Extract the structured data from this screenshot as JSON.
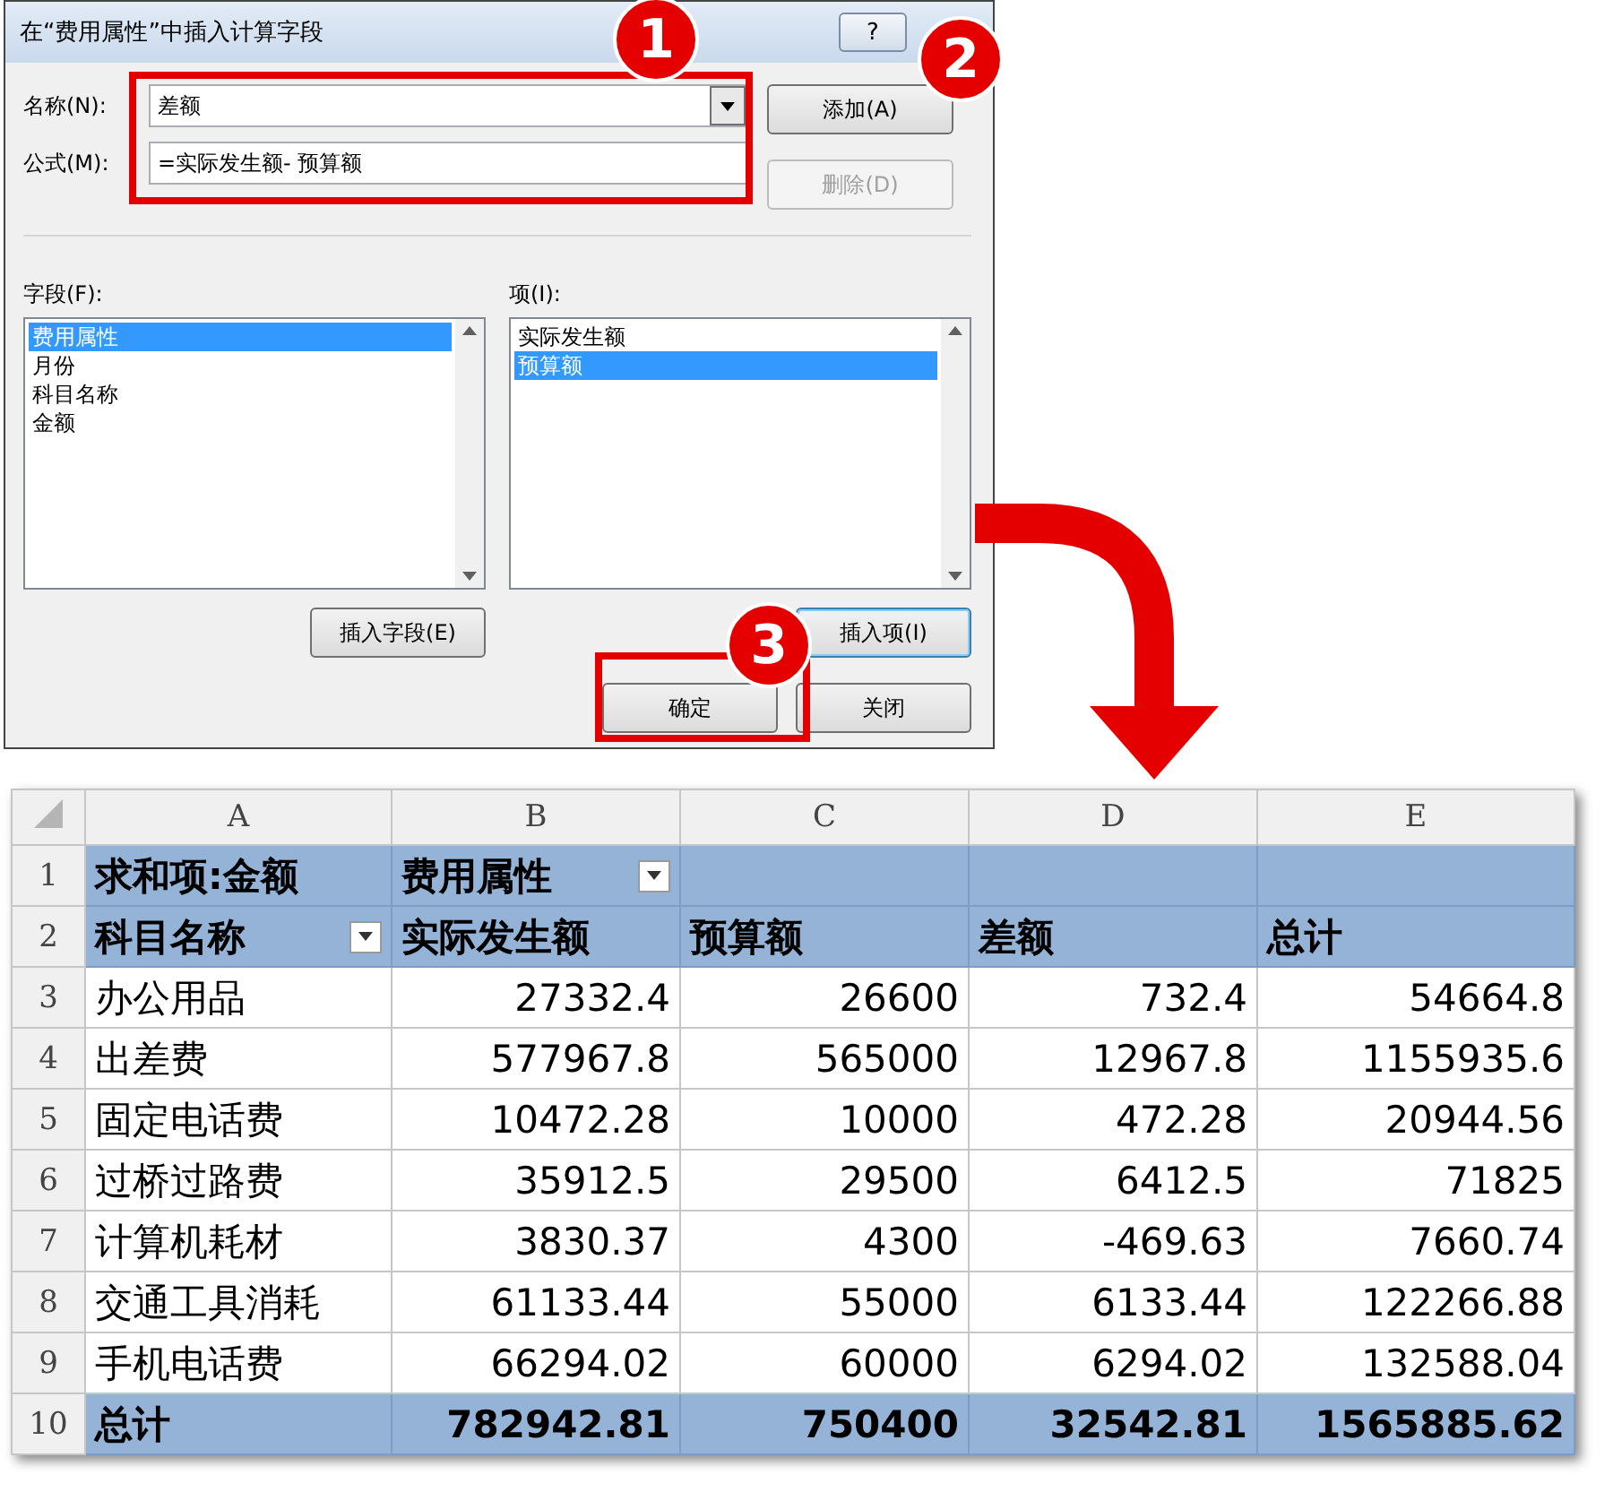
{
  "dialog": {
    "title": "在“费用属性”中插入计算字段",
    "help_button": "?",
    "name_label": "名称(N):",
    "name_value": "差额",
    "formula_label": "公式(M):",
    "formula_value": "=实际发生额- 预算额",
    "add_button": {
      "label": "添加(A)",
      "disabled": false
    },
    "delete_button": {
      "label": "删除(D)",
      "disabled": true
    },
    "fields_label": "字段(F):",
    "fields": [
      {
        "label": "费用属性",
        "selected": true
      },
      {
        "label": "月份",
        "selected": false
      },
      {
        "label": "科目名称",
        "selected": false
      },
      {
        "label": "金额",
        "selected": false
      }
    ],
    "items_label": "项(I):",
    "items": [
      {
        "label": "实际发生额",
        "selected": false
      },
      {
        "label": "预算额",
        "selected": true
      }
    ],
    "insert_field_button": "插入字段(E)",
    "insert_item_button": "插入项(I)",
    "ok_button": "确定",
    "close_button": "关闭"
  },
  "annotations": [
    {
      "number": "1"
    },
    {
      "number": "2"
    },
    {
      "number": "3"
    }
  ],
  "sheet": {
    "columns": [
      "A",
      "B",
      "C",
      "D",
      "E"
    ],
    "rows": [
      {
        "number": "1",
        "kind": "header",
        "cells": [
          {
            "text": "求和项:金额",
            "filter": false
          },
          {
            "text": "费用属性",
            "filter": true
          },
          {
            "filter": false
          },
          {
            "filter": false
          },
          {
            "filter": false
          }
        ]
      },
      {
        "number": "2",
        "kind": "header",
        "cells": [
          {
            "text": "科目名称",
            "filter": true
          },
          {
            "text": "实际发生额",
            "filter": false
          },
          {
            "text": "预算额",
            "filter": false
          },
          {
            "text": "差额",
            "filter": false
          },
          {
            "text": "总计",
            "filter": false
          }
        ]
      },
      {
        "number": "3",
        "kind": "data",
        "cells": [
          "办公用品",
          "27332.4",
          "26600",
          "732.4",
          "54664.8"
        ]
      },
      {
        "number": "4",
        "kind": "data",
        "cells": [
          "出差费",
          "577967.8",
          "565000",
          "12967.8",
          "1155935.6"
        ]
      },
      {
        "number": "5",
        "kind": "data",
        "cells": [
          "固定电话费",
          "10472.28",
          "10000",
          "472.28",
          "20944.56"
        ]
      },
      {
        "number": "6",
        "kind": "data",
        "cells": [
          "过桥过路费",
          "35912.5",
          "29500",
          "6412.5",
          "71825"
        ]
      },
      {
        "number": "7",
        "kind": "data",
        "cells": [
          "计算机耗材",
          "3830.37",
          "4300",
          "-469.63",
          "7660.74"
        ]
      },
      {
        "number": "8",
        "kind": "data",
        "cells": [
          "交通工具消耗",
          "61133.44",
          "55000",
          "6133.44",
          "122266.88"
        ]
      },
      {
        "number": "9",
        "kind": "data",
        "cells": [
          "手机电话费",
          "66294.02",
          "60000",
          "6294.02",
          "132588.04"
        ]
      },
      {
        "number": "10",
        "kind": "total",
        "cells": [
          "总计",
          "782942.81",
          "750400",
          "32542.81",
          "1565885.62"
        ]
      }
    ]
  }
}
